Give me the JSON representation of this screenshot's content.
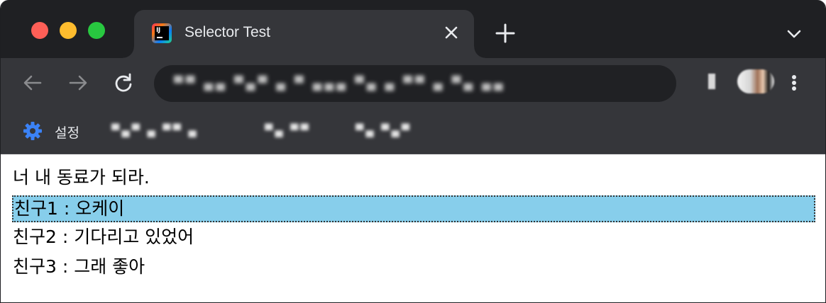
{
  "window": {
    "tab": {
      "title": "Selector Test",
      "favicon": "intellij-icon"
    }
  },
  "toolbar": {
    "url": "▀▀ ▄▄ ▀▄▀ ▄ ▀ ▄▄▄ ▀▄ ▄ ▀▀ ▄ ▀▄ ▄▄",
    "icons": [
      "back-arrow-icon",
      "forward-arrow-icon",
      "reload-icon",
      "more-vert-icon"
    ]
  },
  "bookmarks": {
    "settings_label": "설정",
    "blurred_items": [
      "▀▄▀ ▄ ▀▀ ▄",
      "▀▄ ▀▀",
      "▀▄ ▀▄▀"
    ]
  },
  "content": {
    "lines": [
      "너 내 동료가 되라.",
      "친구1 : 오케이",
      "친구2 : 기다리고 있었어",
      "친구3 : 그래 좋아"
    ],
    "highlight_color": "#87ceeb"
  }
}
